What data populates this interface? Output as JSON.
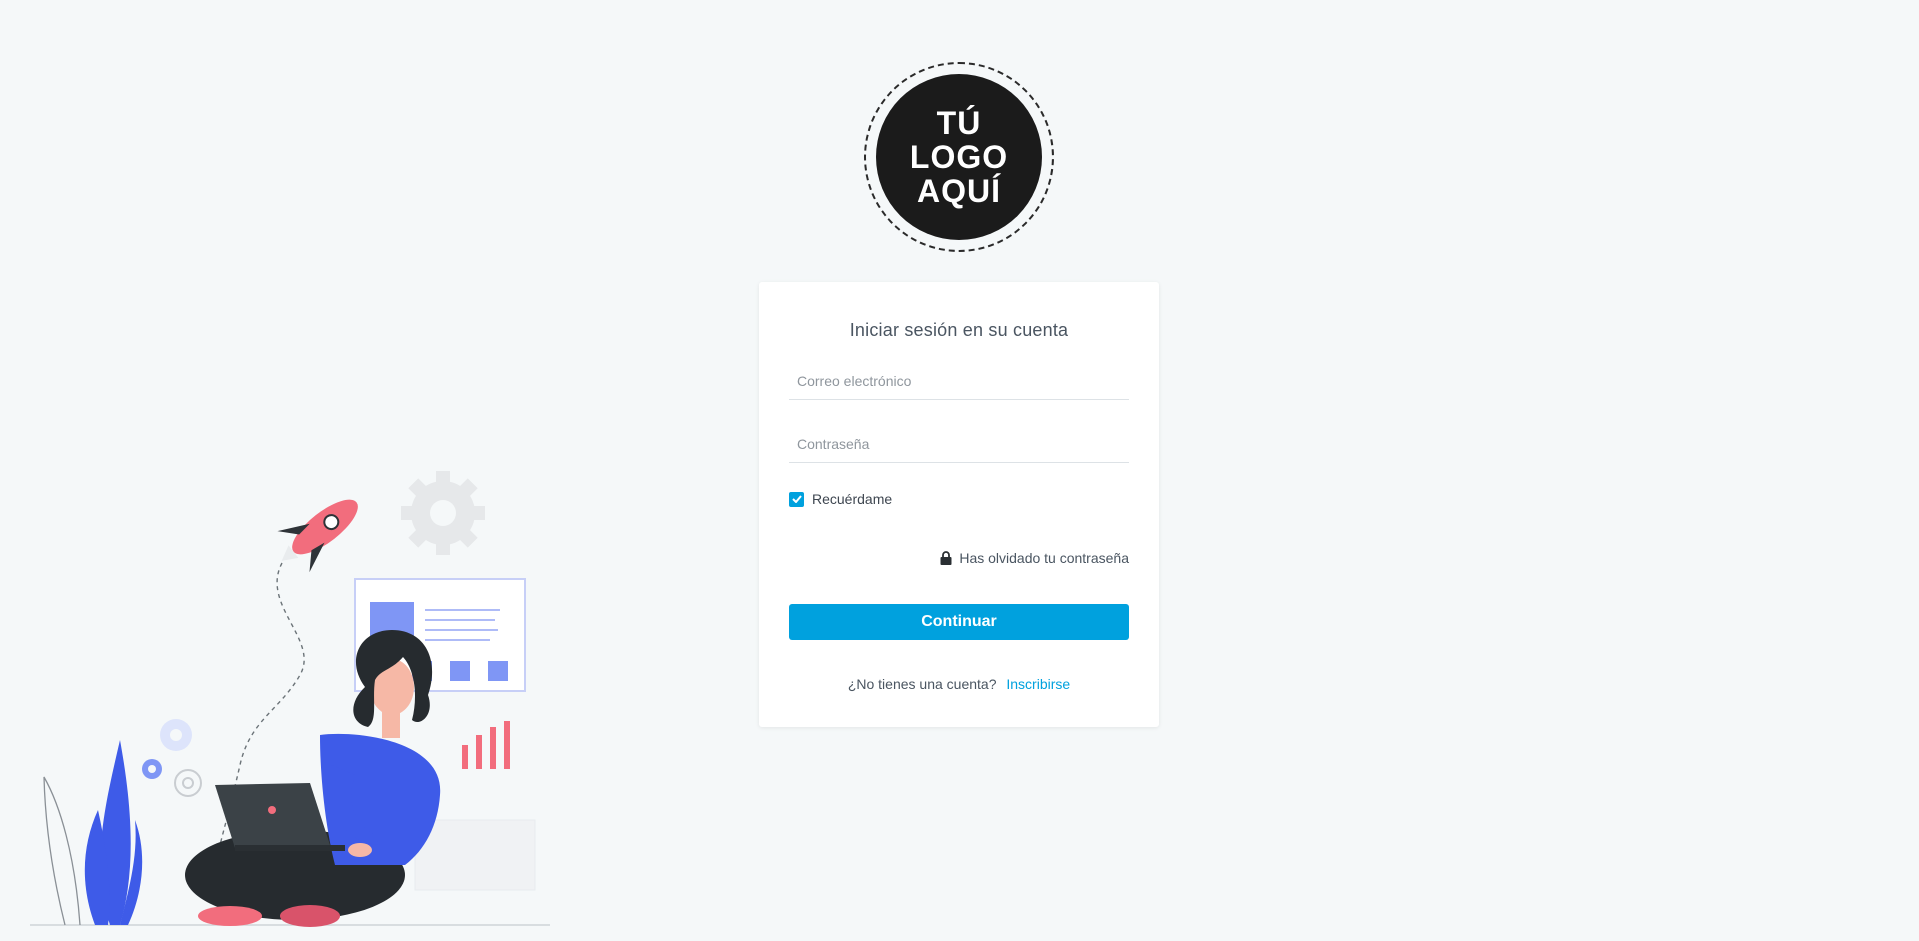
{
  "logo": {
    "line1": "TÚ",
    "line2": "LOGO",
    "line3": "AQUÍ"
  },
  "login": {
    "title": "Iniciar sesión en su cuenta",
    "email_placeholder": "Correo electrónico",
    "email_value": "",
    "password_placeholder": "Contraseña",
    "password_value": "",
    "remember_label": "Recuérdame",
    "remember_checked": true,
    "forgot_label": "Has olvidado tu contraseña",
    "continue_label": "Continuar",
    "no_account_text": "¿No tienes una cuenta?",
    "signup_label": "Inscribirse"
  },
  "colors": {
    "background": "#f5f8f9",
    "accent": "#00a1de",
    "logo_fill": "#1b1b1b",
    "text": "#4a5561"
  },
  "icons": {
    "checkbox": "check-icon",
    "forgot": "lock-icon"
  }
}
